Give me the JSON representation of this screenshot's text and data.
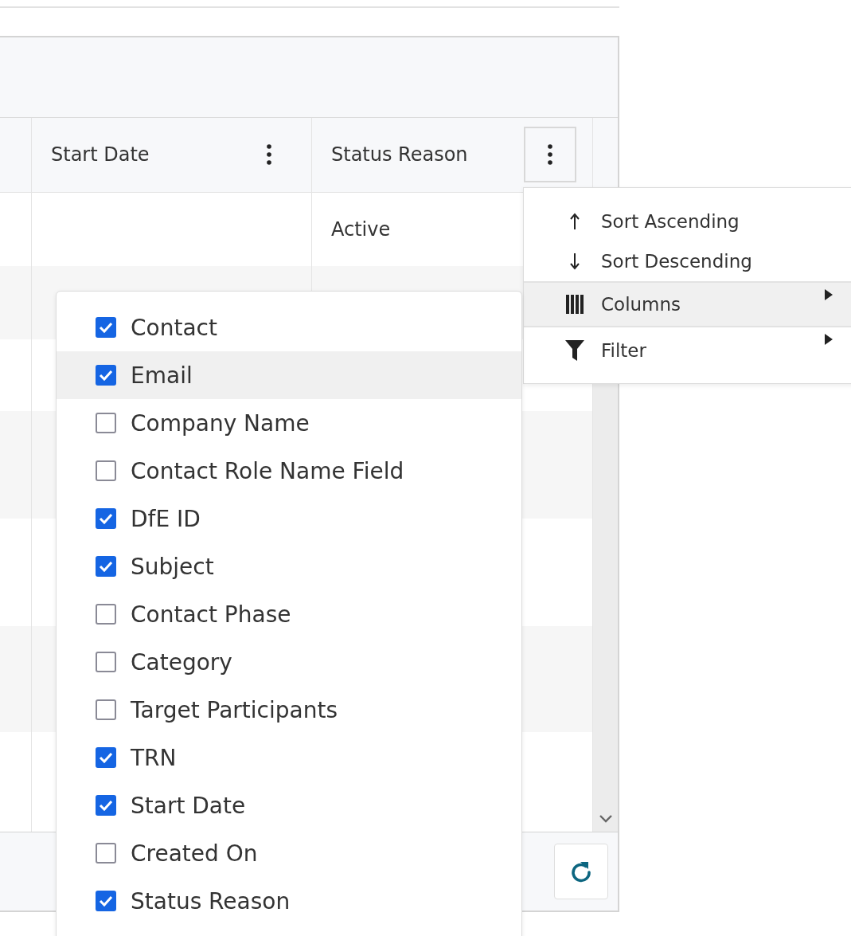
{
  "grid": {
    "columns": [
      {
        "label": "Start Date",
        "menu_open": false
      },
      {
        "label": "Status Reason",
        "menu_open": true
      }
    ],
    "rows": [
      {
        "status_reason": "Active"
      }
    ]
  },
  "column_menu": {
    "items": [
      {
        "kind": "sort-asc",
        "label": "Sort Ascending",
        "submenu": false,
        "highlighted": false,
        "divider_before": false
      },
      {
        "kind": "sort-desc",
        "label": "Sort Descending",
        "submenu": false,
        "highlighted": false,
        "divider_before": false
      },
      {
        "kind": "columns",
        "label": "Columns",
        "submenu": true,
        "highlighted": true,
        "divider_before": true
      },
      {
        "kind": "filter",
        "label": "Filter",
        "submenu": true,
        "highlighted": false,
        "divider_before": true
      }
    ]
  },
  "column_chooser": {
    "items": [
      {
        "label": "Contact",
        "checked": true,
        "highlighted": false
      },
      {
        "label": "Email",
        "checked": true,
        "highlighted": true
      },
      {
        "label": "Company Name",
        "checked": false,
        "highlighted": false
      },
      {
        "label": "Contact Role Name Field",
        "checked": false,
        "highlighted": false
      },
      {
        "label": "DfE ID",
        "checked": true,
        "highlighted": false
      },
      {
        "label": "Subject",
        "checked": true,
        "highlighted": false
      },
      {
        "label": "Contact Phase",
        "checked": false,
        "highlighted": false
      },
      {
        "label": "Category",
        "checked": false,
        "highlighted": false
      },
      {
        "label": "Target Participants",
        "checked": false,
        "highlighted": false
      },
      {
        "label": "TRN",
        "checked": true,
        "highlighted": false
      },
      {
        "label": "Start Date",
        "checked": true,
        "highlighted": false
      },
      {
        "label": "Created On",
        "checked": false,
        "highlighted": false
      },
      {
        "label": "Status Reason",
        "checked": true,
        "highlighted": false
      }
    ]
  }
}
